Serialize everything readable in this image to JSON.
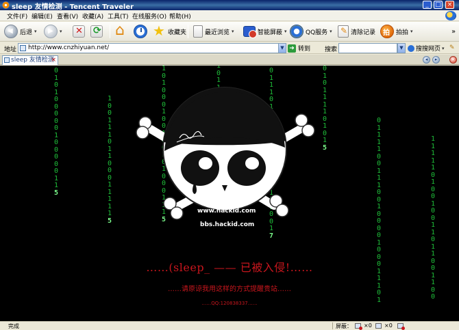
{
  "window": {
    "title": "sleep 友情检测 - Tencent Traveler",
    "min_glyph": "_",
    "max_glyph": "□",
    "close_glyph": "×"
  },
  "menu": [
    "文件(F)",
    "编辑(E)",
    "查看(V)",
    "收藏(A)",
    "工具(T)",
    "在线服务(O)",
    "帮助(H)"
  ],
  "toolbar": {
    "back": "后退",
    "favorites": "收藏夹",
    "recent": "最近浏览",
    "smart_screen": "智能屏蔽",
    "qq_service": "QQ服务",
    "clear_records": "清除记录",
    "snapshot": "拍拍",
    "overflow": "»"
  },
  "address_bar": {
    "label": "地址",
    "url": "http://www.cnzhiyuan.net/",
    "go_label": "转到",
    "search_label": "搜索",
    "search_placeholder": "",
    "search_engine": "搜搜网页"
  },
  "tabs": [
    {
      "label": "sleep 友情检测",
      "active": true,
      "close_glyph": "×"
    }
  ],
  "tab_nav": {
    "prev": "◂",
    "next": "▸",
    "close": "×"
  },
  "page": {
    "site_line_1": "www.hackid.com",
    "site_line_2": "bbs.hackid.com",
    "headline": "……(sleep_ —— 已被入侵!……",
    "subline": "……请原谅我用这样的方式提醒贵站……",
    "qq_line": "……QQ:120838337……",
    "rain_color": "#1fbf3a",
    "text_color": "#c8161d"
  },
  "matrix_columns": [
    {
      "chars": "01010000010000011",
      "lead": "5"
    },
    {
      "chars": "10011101100011111",
      "lead": "5"
    },
    {
      "chars": "101000100100101000111",
      "lead": "5"
    },
    {
      "chars": "10110001101010100",
      "lead": ""
    },
    {
      "chars": "01110110010100011111001",
      "lead": "7"
    },
    {
      "chars": "01011110101",
      "lead": "5"
    },
    {
      "chars": "01111001110010000100011101",
      "lead": ""
    },
    {
      "chars": "11111010010011011001100",
      "lead": ""
    }
  ],
  "status_bar": {
    "left": "完成",
    "screen_label": "屏蔽：",
    "count_1": "×0",
    "count_2": "×0"
  }
}
